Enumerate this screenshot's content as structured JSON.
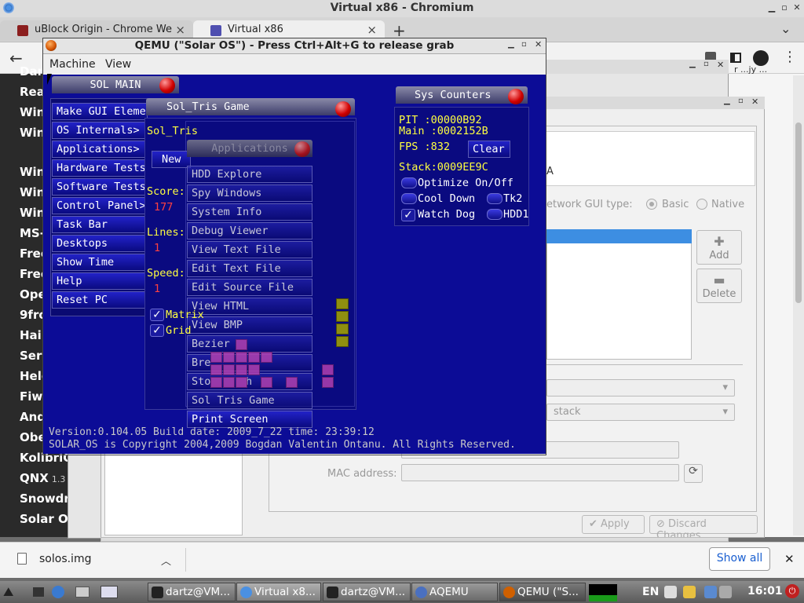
{
  "browser": {
    "title": "Virtual x86 - Chromium",
    "tabs": [
      {
        "label": "uBlock Origin - Chrome We",
        "close": "×"
      },
      {
        "label": "Virtual x86",
        "close": "×"
      }
    ],
    "new_tab": "+",
    "tab_menu": "⌄"
  },
  "sidebar": {
    "items": [
      {
        "label": "Dar"
      },
      {
        "label": "Rea"
      },
      {
        "label": "Win"
      },
      {
        "label": "Win"
      },
      {
        "label": "Win"
      },
      {
        "label": "Win"
      },
      {
        "label": "Win"
      },
      {
        "label": "MS-"
      },
      {
        "label": "Free"
      },
      {
        "label": "Free"
      },
      {
        "label": "Ope"
      },
      {
        "label": "9fro"
      },
      {
        "label": "Haik"
      },
      {
        "label": "Sere"
      },
      {
        "label": "Helo"
      },
      {
        "label": "Fiwi"
      },
      {
        "label": "And"
      },
      {
        "label": "Obe"
      },
      {
        "label": "KolibriO"
      },
      {
        "label": "QNX",
        "sub": "1.3"
      },
      {
        "label": "Snowdr"
      },
      {
        "label": "Solar O"
      }
    ]
  },
  "vbox": {
    "gui_type_label": "etwork GUI type:",
    "gui_basic": "Basic",
    "gui_native": "Native",
    "letter_a": "A",
    "add": "Add",
    "delete": "Delete",
    "stack_text": "stack",
    "mac_label": "MAC address:",
    "apply": "Apply",
    "discard": "Discard Changes",
    "corner_text": "r ...jy ..."
  },
  "qemu": {
    "title": "QEMU (\"Solar OS\") - Press Ctrl+Alt+G to release grab",
    "menu": [
      "Machine",
      "View"
    ]
  },
  "solos": {
    "main_title": "SOL MAIN",
    "main_menu": [
      "Make GUI Eleme",
      "OS Internals>",
      "Applications>",
      "Hardware Tests>",
      "Software Tests",
      "Control Panel>",
      "Task Bar",
      "Desktops",
      "Show Time",
      "Help",
      "Reset PC"
    ],
    "tris_title": "Sol_Tris Game",
    "tris_label": "Sol_Tris",
    "new_btn": "New",
    "score_label": "Score:",
    "score_value": "177",
    "lines_label": "Lines:",
    "lines_value": "1",
    "speed_label": "Speed:",
    "speed_value": "1",
    "matrix_label": "Matrix",
    "grid_label": "Grid",
    "check_mark": "✓",
    "apps_title": "Applications",
    "apps_menu": [
      "HDD Explore",
      "Spy Windows",
      "System Info",
      "Debug Viewer",
      "View Text File",
      "Edit Text File",
      "Edit Source File",
      "View HTML",
      "View BMP",
      "Bezier",
      "Bre",
      "Sto",
      "Sol Tris Game"
    ],
    "apps_sto_suffix": "h",
    "print_screen": "Print Screen",
    "counters_title": "Sys Counters",
    "pit": "PIT  :00000B92",
    "main": "Main :0002152B",
    "fps": "FPS  :832",
    "clear": "Clear",
    "stack": "Stack:0009EE9C",
    "optimize": "Optimize On/Off",
    "cool_down": "Cool Down",
    "tk2": "Tk2",
    "watch_dog": "Watch Dog",
    "hdd1": "HDD1",
    "version_line": "Version:0.104.05  Build date: 2009_7_22  time: 23:39:12",
    "copyright_line": "SOLAR_OS is Copyright 2004,2009 Bogdan Valentin Ontanu. All Rights Reserved."
  },
  "downloads": {
    "file": "solos.img",
    "show_all": "Show all",
    "close": "✕"
  },
  "taskbar": {
    "items": [
      "dartz@VM...",
      "Virtual x8...",
      "dartz@VM...",
      "AQEMU",
      "QEMU (\"S..."
    ],
    "lang": "EN",
    "clock": "16:01"
  }
}
